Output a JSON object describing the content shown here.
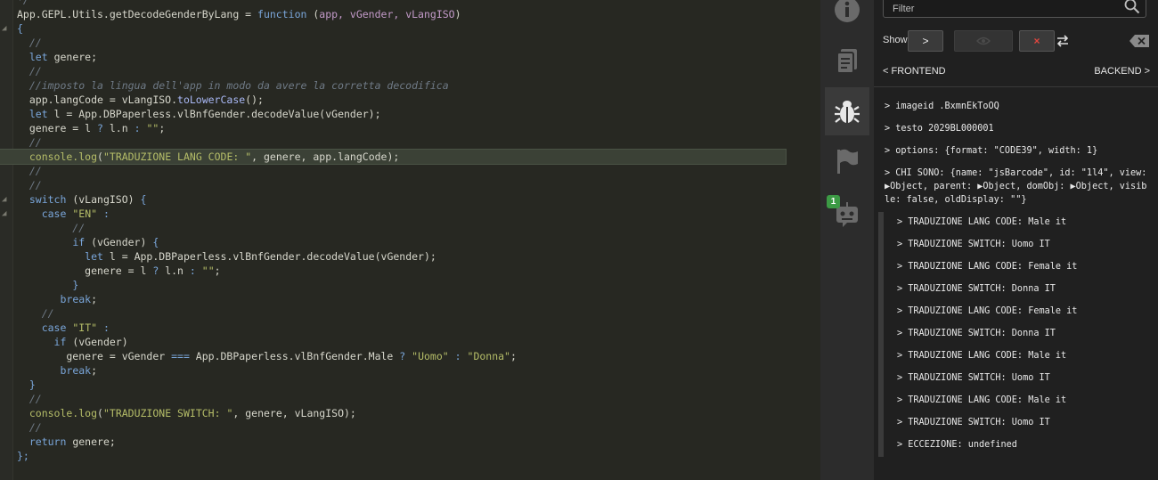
{
  "editor": {
    "lines": [
      [
        {
          "t": "*/",
          "c": "cm"
        }
      ],
      [
        {
          "t": "App.GEPL.Utils.getDecodeGenderByLang",
          "c": "id"
        },
        {
          "t": " = ",
          "c": "op"
        },
        {
          "t": "function",
          "c": "kw"
        },
        {
          "t": " (",
          "c": "op"
        },
        {
          "t": "app, vGender, vLangISO",
          "c": "par"
        },
        {
          "t": ")",
          "c": "op"
        }
      ],
      [
        {
          "t": "{",
          "c": "kw"
        }
      ],
      [
        {
          "t": "  //",
          "c": "cm"
        }
      ],
      [
        {
          "t": "  ",
          "c": "op"
        },
        {
          "t": "let",
          "c": "kw"
        },
        {
          "t": " genere;",
          "c": "id"
        }
      ],
      [
        {
          "t": "  //",
          "c": "cm"
        }
      ],
      [
        {
          "t": "  //imposto la lingua dell'app in modo da avere la corretta decodifica",
          "c": "cm"
        }
      ],
      [
        {
          "t": "  app.langCode = vLangISO.",
          "c": "id"
        },
        {
          "t": "toLowerCase",
          "c": "fn"
        },
        {
          "t": "();",
          "c": "id"
        }
      ],
      [
        {
          "t": "  ",
          "c": "op"
        },
        {
          "t": "let",
          "c": "kw"
        },
        {
          "t": " l = App.DBPaperless.vlBnfGender.",
          "c": "id"
        },
        {
          "t": "decodeValue",
          "c": "id"
        },
        {
          "t": "(vGender);",
          "c": "id"
        }
      ],
      [
        {
          "t": "  genere = l ",
          "c": "id"
        },
        {
          "t": "?",
          "c": "kw"
        },
        {
          "t": " l.n ",
          "c": "id"
        },
        {
          "t": ":",
          "c": "kw"
        },
        {
          "t": " ",
          "c": "op"
        },
        {
          "t": "\"\"",
          "c": "str"
        },
        {
          "t": ";",
          "c": "id"
        }
      ],
      [
        {
          "t": "  //",
          "c": "cm"
        }
      ],
      [
        {
          "t": "  console.",
          "c": "str"
        },
        {
          "t": "log",
          "c": "str"
        },
        {
          "t": "(",
          "c": "id"
        },
        {
          "t": "\"TRADUZIONE LANG CODE: \"",
          "c": "str"
        },
        {
          "t": ", genere, app.langCode);",
          "c": "id"
        }
      ],
      [
        {
          "t": "  //",
          "c": "cm"
        }
      ],
      [
        {
          "t": "  //",
          "c": "cm"
        }
      ],
      [
        {
          "t": "  ",
          "c": "op"
        },
        {
          "t": "switch",
          "c": "kw"
        },
        {
          "t": " (vLangISO) ",
          "c": "id"
        },
        {
          "t": "{",
          "c": "kw"
        }
      ],
      [
        {
          "t": "    ",
          "c": "op"
        },
        {
          "t": "case",
          "c": "kw"
        },
        {
          "t": " ",
          "c": "op"
        },
        {
          "t": "\"EN\"",
          "c": "str"
        },
        {
          "t": " :",
          "c": "kw"
        }
      ],
      [
        {
          "t": "         //",
          "c": "cm"
        }
      ],
      [
        {
          "t": "         ",
          "c": "op"
        },
        {
          "t": "if",
          "c": "kw"
        },
        {
          "t": " (vGender) ",
          "c": "id"
        },
        {
          "t": "{",
          "c": "kw"
        }
      ],
      [
        {
          "t": "           ",
          "c": "op"
        },
        {
          "t": "let",
          "c": "kw"
        },
        {
          "t": " l = App.DBPaperless.vlBnfGender.decodeValue(vGender);",
          "c": "id"
        }
      ],
      [
        {
          "t": "           genere = l ",
          "c": "id"
        },
        {
          "t": "?",
          "c": "kw"
        },
        {
          "t": " l.n ",
          "c": "id"
        },
        {
          "t": ":",
          "c": "kw"
        },
        {
          "t": " ",
          "c": "op"
        },
        {
          "t": "\"\"",
          "c": "str"
        },
        {
          "t": ";",
          "c": "id"
        }
      ],
      [
        {
          "t": "         ",
          "c": "op"
        },
        {
          "t": "}",
          "c": "kw"
        }
      ],
      [
        {
          "t": "       ",
          "c": "op"
        },
        {
          "t": "break",
          "c": "kw"
        },
        {
          "t": ";",
          "c": "id"
        }
      ],
      [
        {
          "t": "    //",
          "c": "cm"
        }
      ],
      [
        {
          "t": "    ",
          "c": "op"
        },
        {
          "t": "case",
          "c": "kw"
        },
        {
          "t": " ",
          "c": "op"
        },
        {
          "t": "\"IT\"",
          "c": "str"
        },
        {
          "t": " :",
          "c": "kw"
        }
      ],
      [
        {
          "t": "      ",
          "c": "op"
        },
        {
          "t": "if",
          "c": "kw"
        },
        {
          "t": " (vGender)",
          "c": "id"
        }
      ],
      [
        {
          "t": "        genere = vGender ",
          "c": "id"
        },
        {
          "t": "===",
          "c": "kw"
        },
        {
          "t": " App.DBPaperless.vlBnfGender.Male ",
          "c": "id"
        },
        {
          "t": "?",
          "c": "kw"
        },
        {
          "t": " ",
          "c": "op"
        },
        {
          "t": "\"Uomo\"",
          "c": "str"
        },
        {
          "t": " ",
          "c": "op"
        },
        {
          "t": ":",
          "c": "kw"
        },
        {
          "t": " ",
          "c": "op"
        },
        {
          "t": "\"Donna\"",
          "c": "str"
        },
        {
          "t": ";",
          "c": "id"
        }
      ],
      [
        {
          "t": "       ",
          "c": "op"
        },
        {
          "t": "break",
          "c": "kw"
        },
        {
          "t": ";",
          "c": "id"
        }
      ],
      [
        {
          "t": "  ",
          "c": "op"
        },
        {
          "t": "}",
          "c": "kw"
        }
      ],
      [
        {
          "t": "  //",
          "c": "cm"
        }
      ],
      [
        {
          "t": "  console.",
          "c": "str"
        },
        {
          "t": "log",
          "c": "str"
        },
        {
          "t": "(",
          "c": "id"
        },
        {
          "t": "\"TRADUZIONE SWITCH: \"",
          "c": "str"
        },
        {
          "t": ", genere, vLangISO);",
          "c": "id"
        }
      ],
      [
        {
          "t": "  //",
          "c": "cm"
        }
      ],
      [
        {
          "t": "  ",
          "c": "op"
        },
        {
          "t": "return",
          "c": "kw"
        },
        {
          "t": " genere;",
          "c": "id"
        }
      ],
      [
        {
          "t": "};",
          "c": "kw"
        }
      ]
    ],
    "highlighted_line": 11
  },
  "activity": {
    "badge": "1",
    "icons": [
      "info-icon",
      "document-icon",
      "bug-icon",
      "flag-icon",
      "robot-icon"
    ]
  },
  "panel": {
    "filter_placeholder": "Filter",
    "show_label": "Show",
    "next_label": ">",
    "clear_label": "×",
    "frontend_label": "< FRONTEND",
    "backend_label": "BACKEND >",
    "log": [
      {
        "text": "> imageid .BxmnEkToOQ",
        "sub": false
      },
      {
        "text": "> testo 2029BL000001",
        "sub": false
      },
      {
        "text": "> options: {format: \"CODE39\", width: 1}",
        "sub": false
      },
      {
        "text": "> CHI SONO: {name: \"jsBarcode\", id: \"1l4\", view: ▶Object, parent: ▶Object, domObj: ▶Object, visible: false, oldDisplay: \"\"}",
        "sub": false
      },
      {
        "text": "> TRADUZIONE LANG CODE: Male it",
        "sub": true
      },
      {
        "text": "> TRADUZIONE SWITCH: Uomo IT",
        "sub": true
      },
      {
        "text": "> TRADUZIONE LANG CODE: Female it",
        "sub": true
      },
      {
        "text": "> TRADUZIONE SWITCH: Donna IT",
        "sub": true
      },
      {
        "text": "> TRADUZIONE LANG CODE: Female it",
        "sub": true
      },
      {
        "text": "> TRADUZIONE SWITCH: Donna IT",
        "sub": true
      },
      {
        "text": "> TRADUZIONE LANG CODE: Male it",
        "sub": true
      },
      {
        "text": "> TRADUZIONE SWITCH: Uomo IT",
        "sub": true
      },
      {
        "text": "> TRADUZIONE LANG CODE: Male it",
        "sub": true
      },
      {
        "text": "> TRADUZIONE SWITCH: Uomo IT",
        "sub": true
      },
      {
        "text": "> ECCEZIONE: undefined",
        "sub": true
      }
    ]
  }
}
